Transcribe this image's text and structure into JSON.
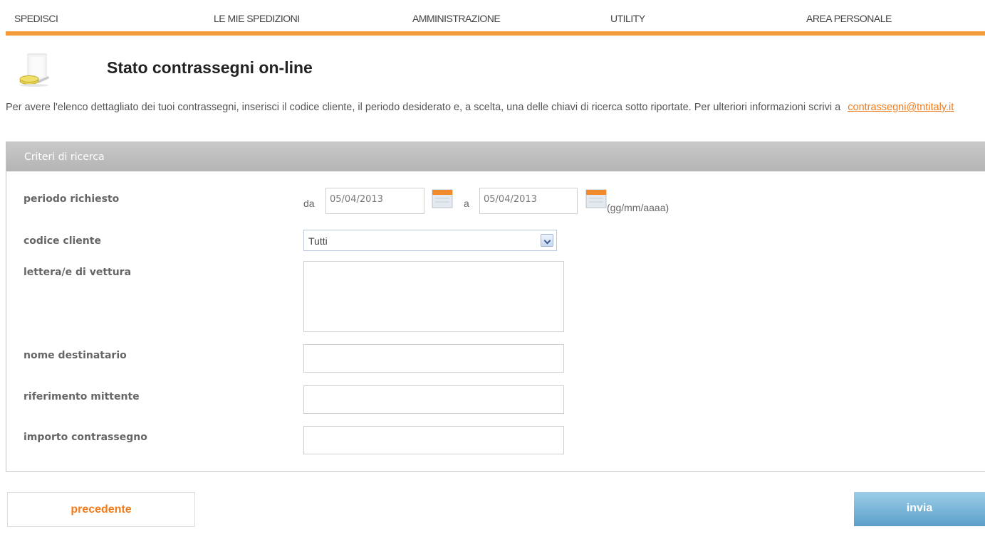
{
  "nav": {
    "items": [
      {
        "label": "SPEDISCI"
      },
      {
        "label": "LE MIE SPEDIZIONI"
      },
      {
        "label": "AMMINISTRAZIONE"
      },
      {
        "label": "UTILITY"
      },
      {
        "label": "AREA PERSONALE"
      }
    ]
  },
  "header": {
    "title": "Stato contrassegni on-line",
    "icon": "document-coins-icon"
  },
  "intro": {
    "text": "Per avere l'elenco dettagliato dei tuoi contrassegni, inserisci il codice cliente, il periodo desiderato e, a scelta, una delle chiavi di ricerca sotto riportate. Per ulteriori informazioni scrivi a",
    "email": "contrassegni@tntitaly.it"
  },
  "panel": {
    "title": "Criteri di ricerca"
  },
  "form": {
    "period": {
      "label": "periodo richiesto",
      "from_label": "da",
      "from_value": "05/04/2013",
      "to_label": "a",
      "to_value": "05/04/2013",
      "format_hint": "(gg/mm/aaaa)"
    },
    "client_code": {
      "label": "codice cliente",
      "selected": "Tutti"
    },
    "waybill": {
      "label": "lettera/e di vettura",
      "value": ""
    },
    "recipient": {
      "label": "nome destinatario",
      "value": ""
    },
    "sender_ref": {
      "label": "riferimento mittente",
      "value": ""
    },
    "amount": {
      "label": "importo contrassegno",
      "value": ""
    }
  },
  "buttons": {
    "previous": "precedente",
    "submit": "invia"
  },
  "colors": {
    "accent_orange": "#f39a39",
    "link_orange": "#f07c1e",
    "panel_header": "#b4b4b4",
    "submit_blue": "#5a9fc9"
  }
}
